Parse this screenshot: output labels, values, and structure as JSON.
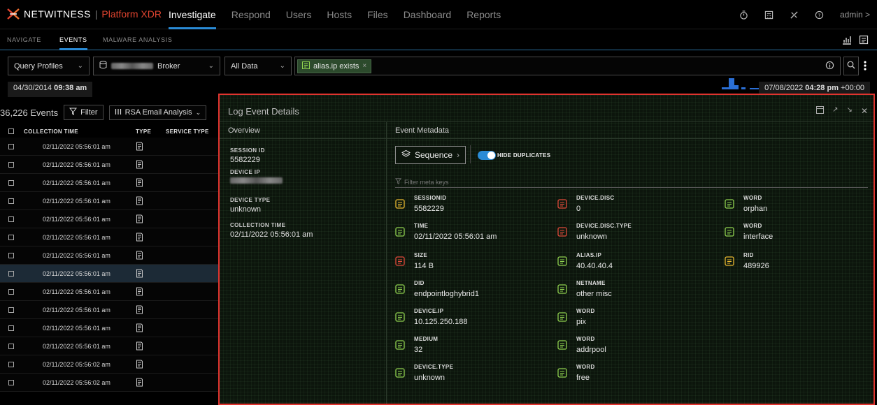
{
  "app": {
    "brand": "NETWITNESS",
    "separator": "|",
    "product": "Platform XDR"
  },
  "topnav": [
    "Investigate",
    "Respond",
    "Users",
    "Hosts",
    "Files",
    "Dashboard",
    "Reports"
  ],
  "user": "admin >",
  "subnav": [
    "NAVIGATE",
    "EVENTS",
    "MALWARE ANALYSIS"
  ],
  "query": {
    "profiles": "Query Profiles",
    "service": "Broker",
    "data_scope": "All Data",
    "filter_pill": "alias.ip exists"
  },
  "time": {
    "start_date": "04/30/2014",
    "start_time": "09:38 am",
    "end_date": "07/08/2022",
    "end_time": "04:28 pm",
    "end_tz": "+00:00"
  },
  "events": {
    "count": "36,226 Events",
    "filter_label": "Filter",
    "profile_label": "RSA Email Analysis",
    "columns": [
      "COLLECTION TIME",
      "TYPE",
      "SERVICE TYPE"
    ],
    "rows": [
      "02/11/2022 05:56:01 am",
      "02/11/2022 05:56:01 am",
      "02/11/2022 05:56:01 am",
      "02/11/2022 05:56:01 am",
      "02/11/2022 05:56:01 am",
      "02/11/2022 05:56:01 am",
      "02/11/2022 05:56:01 am",
      "02/11/2022 05:56:01 am",
      "02/11/2022 05:56:01 am",
      "02/11/2022 05:56:01 am",
      "02/11/2022 05:56:01 am",
      "02/11/2022 05:56:01 am",
      "02/11/2022 05:56:02 am",
      "02/11/2022 05:56:02 am"
    ],
    "selected_row_index": 7
  },
  "details": {
    "title": "Log Event Details",
    "overview_header": "Overview",
    "metadata_header": "Event Metadata",
    "overview": [
      {
        "key": "SESSION ID",
        "value": "5582229"
      },
      {
        "key": "DEVICE IP",
        "value": ""
      },
      {
        "key": "DEVICE TYPE",
        "value": "unknown"
      },
      {
        "key": "COLLECTION TIME",
        "value": "02/11/2022 05:56:01 am"
      }
    ],
    "sequence_label": "Sequence",
    "hide_duplicates_label": "HIDE DUPLICATES",
    "filter_placeholder": "Filter meta keys",
    "metadata": [
      {
        "key": "SESSIONID",
        "value": "5582229",
        "icon": "stopwatch-icon"
      },
      {
        "key": "TIME",
        "value": "02/11/2022 05:56:01 am",
        "icon": "clock-icon"
      },
      {
        "key": "SIZE",
        "value": "114 B",
        "icon": "size-icon"
      },
      {
        "key": "DID",
        "value": "endpointloghybrid1",
        "icon": "database-icon"
      },
      {
        "key": "DEVICE.IP",
        "value": "10.125.250.188",
        "icon": "ip-icon"
      },
      {
        "key": "MEDIUM",
        "value": "32",
        "icon": "medium-icon"
      },
      {
        "key": "DEVICE.TYPE",
        "value": "unknown",
        "icon": "database-icon"
      },
      {
        "key": "DEVICE.DISC",
        "value": "0",
        "icon": "device-disc-icon"
      },
      {
        "key": "DEVICE.DISC.TYPE",
        "value": "unknown",
        "icon": "device-disc-icon"
      },
      {
        "key": "ALIAS.IP",
        "value": "40.40.40.4",
        "icon": "alias-ip-icon"
      },
      {
        "key": "NETNAME",
        "value": "other misc",
        "icon": "netname-icon"
      },
      {
        "key": "WORD",
        "value": "pix",
        "icon": "word-icon"
      },
      {
        "key": "WORD",
        "value": "addrpool",
        "icon": "word-icon"
      },
      {
        "key": "WORD",
        "value": "free",
        "icon": "word-icon"
      },
      {
        "key": "WORD",
        "value": "orphan",
        "icon": "word-icon"
      },
      {
        "key": "WORD",
        "value": "interface",
        "icon": "word-icon"
      },
      {
        "key": "RID",
        "value": "489926",
        "icon": "rid-icon"
      }
    ]
  },
  "colors": {
    "accent": "#2a8bd6",
    "brand_red": "#e0442f",
    "panel_border": "#e0342f",
    "icon_green": "#8fd14f",
    "icon_red": "#e04a3a",
    "icon_yellow": "#e8b830"
  }
}
